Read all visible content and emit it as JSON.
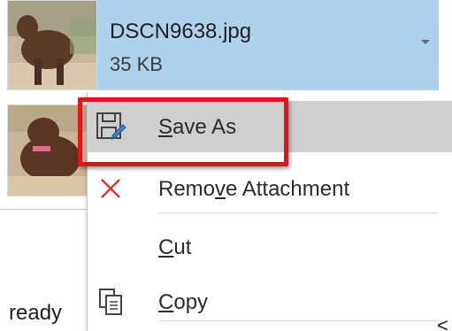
{
  "attachment": {
    "filename": "DSCN9638.jpg",
    "size": "35 KB",
    "accent": "#aed2ee"
  },
  "context_menu": {
    "items": [
      {
        "label_underlined": "S",
        "label_rest": "ave As",
        "icon": "save-as-icon"
      },
      {
        "label_before": "Remo",
        "label_underlined": "v",
        "label_rest": "e Attachment",
        "icon": "remove-x-icon"
      },
      {
        "label_underlined": "C",
        "label_rest": "ut",
        "icon": ""
      },
      {
        "label_underlined": "C",
        "label_rest": "opy",
        "icon": "copy-icon"
      }
    ],
    "highlight_color": "#e3141a"
  },
  "status": {
    "text": "ready"
  },
  "edge_glyph": "<"
}
